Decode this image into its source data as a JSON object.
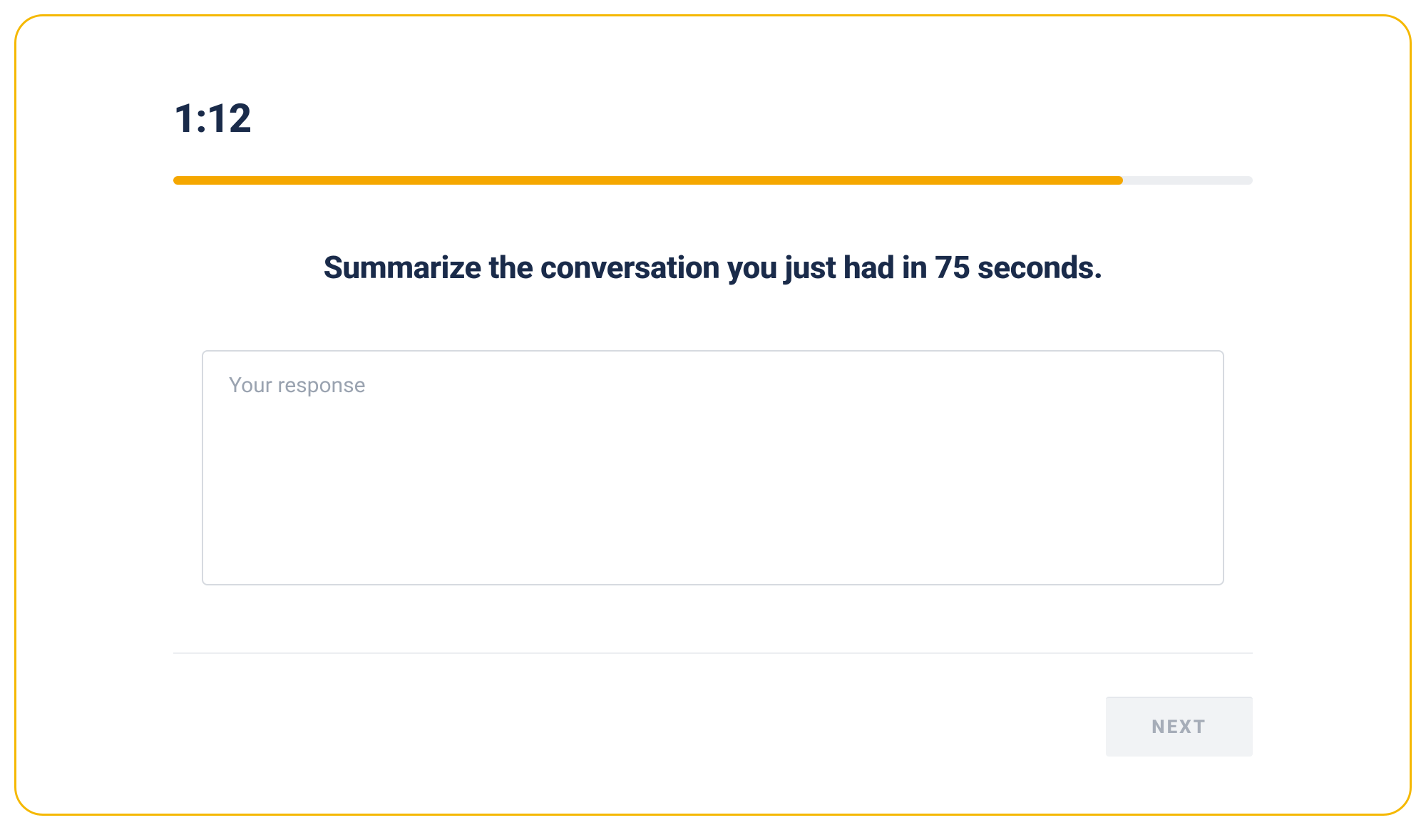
{
  "timer": "1:12",
  "progress": {
    "percent": 88
  },
  "prompt": "Summarize the conversation you just had in 75 seconds.",
  "response": {
    "value": "",
    "placeholder": "Your response"
  },
  "footer": {
    "next_label": "NEXT"
  }
}
